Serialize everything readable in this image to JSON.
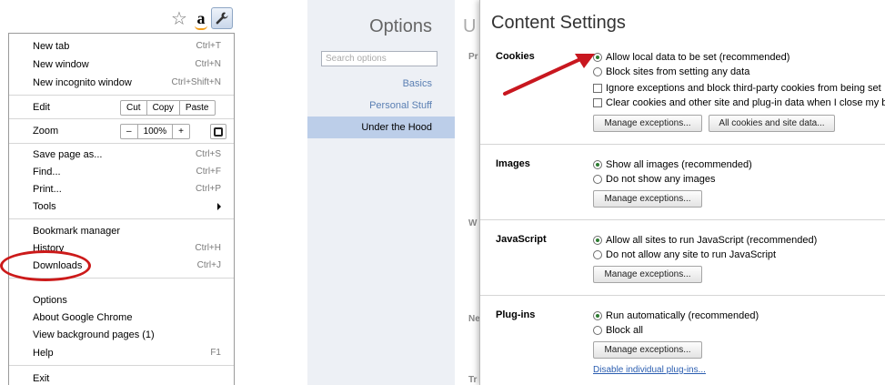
{
  "toolbar": {
    "icons": [
      "star-icon",
      "amazon-icon",
      "wrench-icon"
    ],
    "amazon_label": "a"
  },
  "menu": {
    "new_tab": "New tab",
    "new_tab_shortcut": "Ctrl+T",
    "new_window": "New window",
    "new_window_shortcut": "Ctrl+N",
    "new_incognito": "New incognito window",
    "new_incognito_shortcut": "Ctrl+Shift+N",
    "edit": "Edit",
    "cut": "Cut",
    "copy": "Copy",
    "paste": "Paste",
    "zoom": "Zoom",
    "zoom_minus": "–",
    "zoom_value": "100%",
    "zoom_plus": "+",
    "save_page": "Save page as...",
    "save_page_shortcut": "Ctrl+S",
    "find": "Find...",
    "find_shortcut": "Ctrl+F",
    "print": "Print...",
    "print_shortcut": "Ctrl+P",
    "tools": "Tools",
    "bookmark_manager": "Bookmark manager",
    "history": "History",
    "history_shortcut": "Ctrl+H",
    "downloads": "Downloads",
    "downloads_shortcut": "Ctrl+J",
    "options": "Options",
    "about": "About Google Chrome",
    "background_pages": "View background pages (1)",
    "help": "Help",
    "help_shortcut": "F1",
    "exit": "Exit"
  },
  "options_page": {
    "title": "Options",
    "search_placeholder": "Search options",
    "nav": [
      "Basics",
      "Personal Stuff",
      "Under the Hood"
    ],
    "selected_nav": "Under the Hood",
    "background_title": "U",
    "background_labels": [
      "Pr",
      "W",
      "Ne",
      "Tr"
    ]
  },
  "content_settings": {
    "title": "Content Settings",
    "cookies": {
      "label": "Cookies",
      "opt1": "Allow local data to be set (recommended)",
      "opt2": "Block sites from setting any data",
      "chk1": "Ignore exceptions and block third-party cookies from being set",
      "chk2": "Clear cookies and other site and plug-in data when I close my browser",
      "btn1": "Manage exceptions...",
      "btn2": "All cookies and site data..."
    },
    "images": {
      "label": "Images",
      "opt1": "Show all images (recommended)",
      "opt2": "Do not show any images",
      "btn1": "Manage exceptions..."
    },
    "javascript": {
      "label": "JavaScript",
      "opt1": "Allow all sites to run JavaScript (recommended)",
      "opt2": "Do not allow any site to run JavaScript",
      "btn1": "Manage exceptions..."
    },
    "plugins": {
      "label": "Plug-ins",
      "opt1": "Run automatically (recommended)",
      "opt2": "Block all",
      "btn1": "Manage exceptions...",
      "link": "Disable individual plug-ins..."
    }
  },
  "colors": {
    "highlight": "#cc1a1a",
    "sidebar_bg": "#edf0f5",
    "selected_nav_bg": "#bccee9",
    "link": "#2a5db0"
  }
}
